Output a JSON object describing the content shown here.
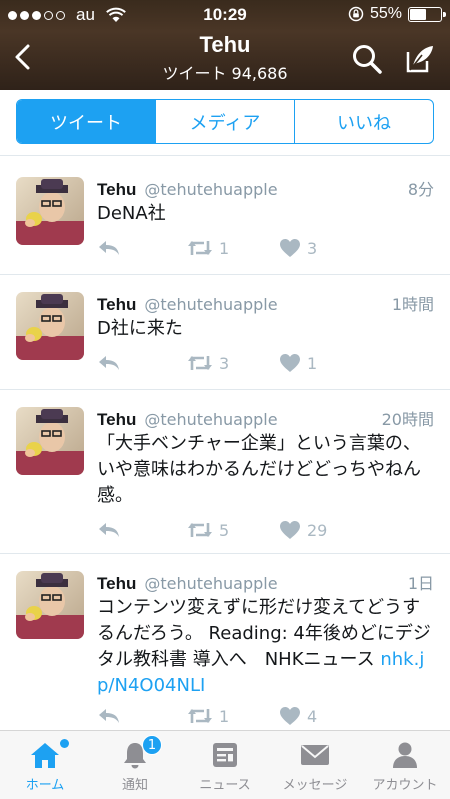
{
  "status_bar": {
    "carrier": "au",
    "time": "10:29",
    "battery": "55%",
    "battery_level": 0.55
  },
  "header": {
    "title": "Tehu",
    "subtitle": "ツイート 94,686",
    "icons": {
      "back": "chevron-left-icon",
      "search": "search-icon",
      "compose": "compose-icon"
    }
  },
  "segments": [
    {
      "label": "ツイート",
      "active": true
    },
    {
      "label": "メディア",
      "active": false
    },
    {
      "label": "いいね",
      "active": false
    }
  ],
  "tweets": [
    {
      "name": "Tehu",
      "handle": "@tehutehuapple",
      "time": "8分",
      "text": "DeNA社",
      "link": "",
      "retweets": "1",
      "likes": "3"
    },
    {
      "name": "Tehu",
      "handle": "@tehutehuapple",
      "time": "1時間",
      "text": "D社に来た",
      "link": "",
      "retweets": "3",
      "likes": "1"
    },
    {
      "name": "Tehu",
      "handle": "@tehutehuapple",
      "time": "20時間",
      "text": "「大手ベンチャー企業」という言葉の、いや意味はわかるんだけどどっちやねん感。",
      "link": "",
      "retweets": "5",
      "likes": "29"
    },
    {
      "name": "Tehu",
      "handle": "@tehutehuapple",
      "time": "1日",
      "text": "コンテンツ変えずに形だけ変えてどうするんだろう。 Reading: 4年後めどにデジタル教科書 導入へ　NHKニュース ",
      "link": "nhk.jp/N4O04NLI",
      "retweets": "1",
      "likes": "4"
    }
  ],
  "tabbar": {
    "items": [
      {
        "label": "ホーム",
        "icon": "home-icon",
        "active": true
      },
      {
        "label": "通知",
        "icon": "bell-icon",
        "active": false,
        "badge": "1"
      },
      {
        "label": "ニュース",
        "icon": "news-icon",
        "active": false
      },
      {
        "label": "メッセージ",
        "icon": "envelope-icon",
        "active": false
      },
      {
        "label": "アカウント",
        "icon": "person-icon",
        "active": false
      }
    ]
  },
  "colors": {
    "accent": "#1da1f2",
    "muted": "#8899a6",
    "action": "#aab8c2"
  }
}
